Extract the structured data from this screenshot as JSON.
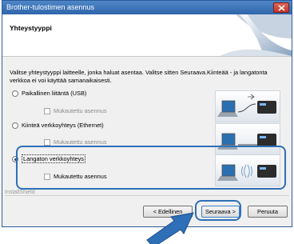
{
  "window": {
    "title": "Brother-tulostimen asennus"
  },
  "header": {
    "section_title": "Yhteystyyppi"
  },
  "description": "Valitse yhteystyyppi laitteelle, jonka haluat asentaa. Valitse sitten Seuraava.Kiinteää - ja langatonta verkkoa ei voi käyttää samanaikaisesti.",
  "options": [
    {
      "label": "Paikallinen liitäntä (USB)",
      "selected": false,
      "custom_label": "Mukautettu asennus",
      "custom_enabled": false,
      "icon": "usb-connection-icon"
    },
    {
      "label": "Kiinteä verkkoyhteys (Ethernet)",
      "selected": false,
      "custom_label": "Mukautettu asennus",
      "custom_enabled": false,
      "icon": "ethernet-connection-icon"
    },
    {
      "label": "Langaton verkkoyhteys",
      "selected": true,
      "custom_label": "Mukautettu asennus",
      "custom_enabled": true,
      "icon": "wireless-connection-icon"
    }
  ],
  "footer": {
    "installshield_label": "InstallShield",
    "back_label": "< Edellinen",
    "next_label": "Seuraava >",
    "cancel_label": "Peruuta"
  },
  "colors": {
    "accent": "#2f6fb7",
    "titlebar": "#2f66ab"
  }
}
